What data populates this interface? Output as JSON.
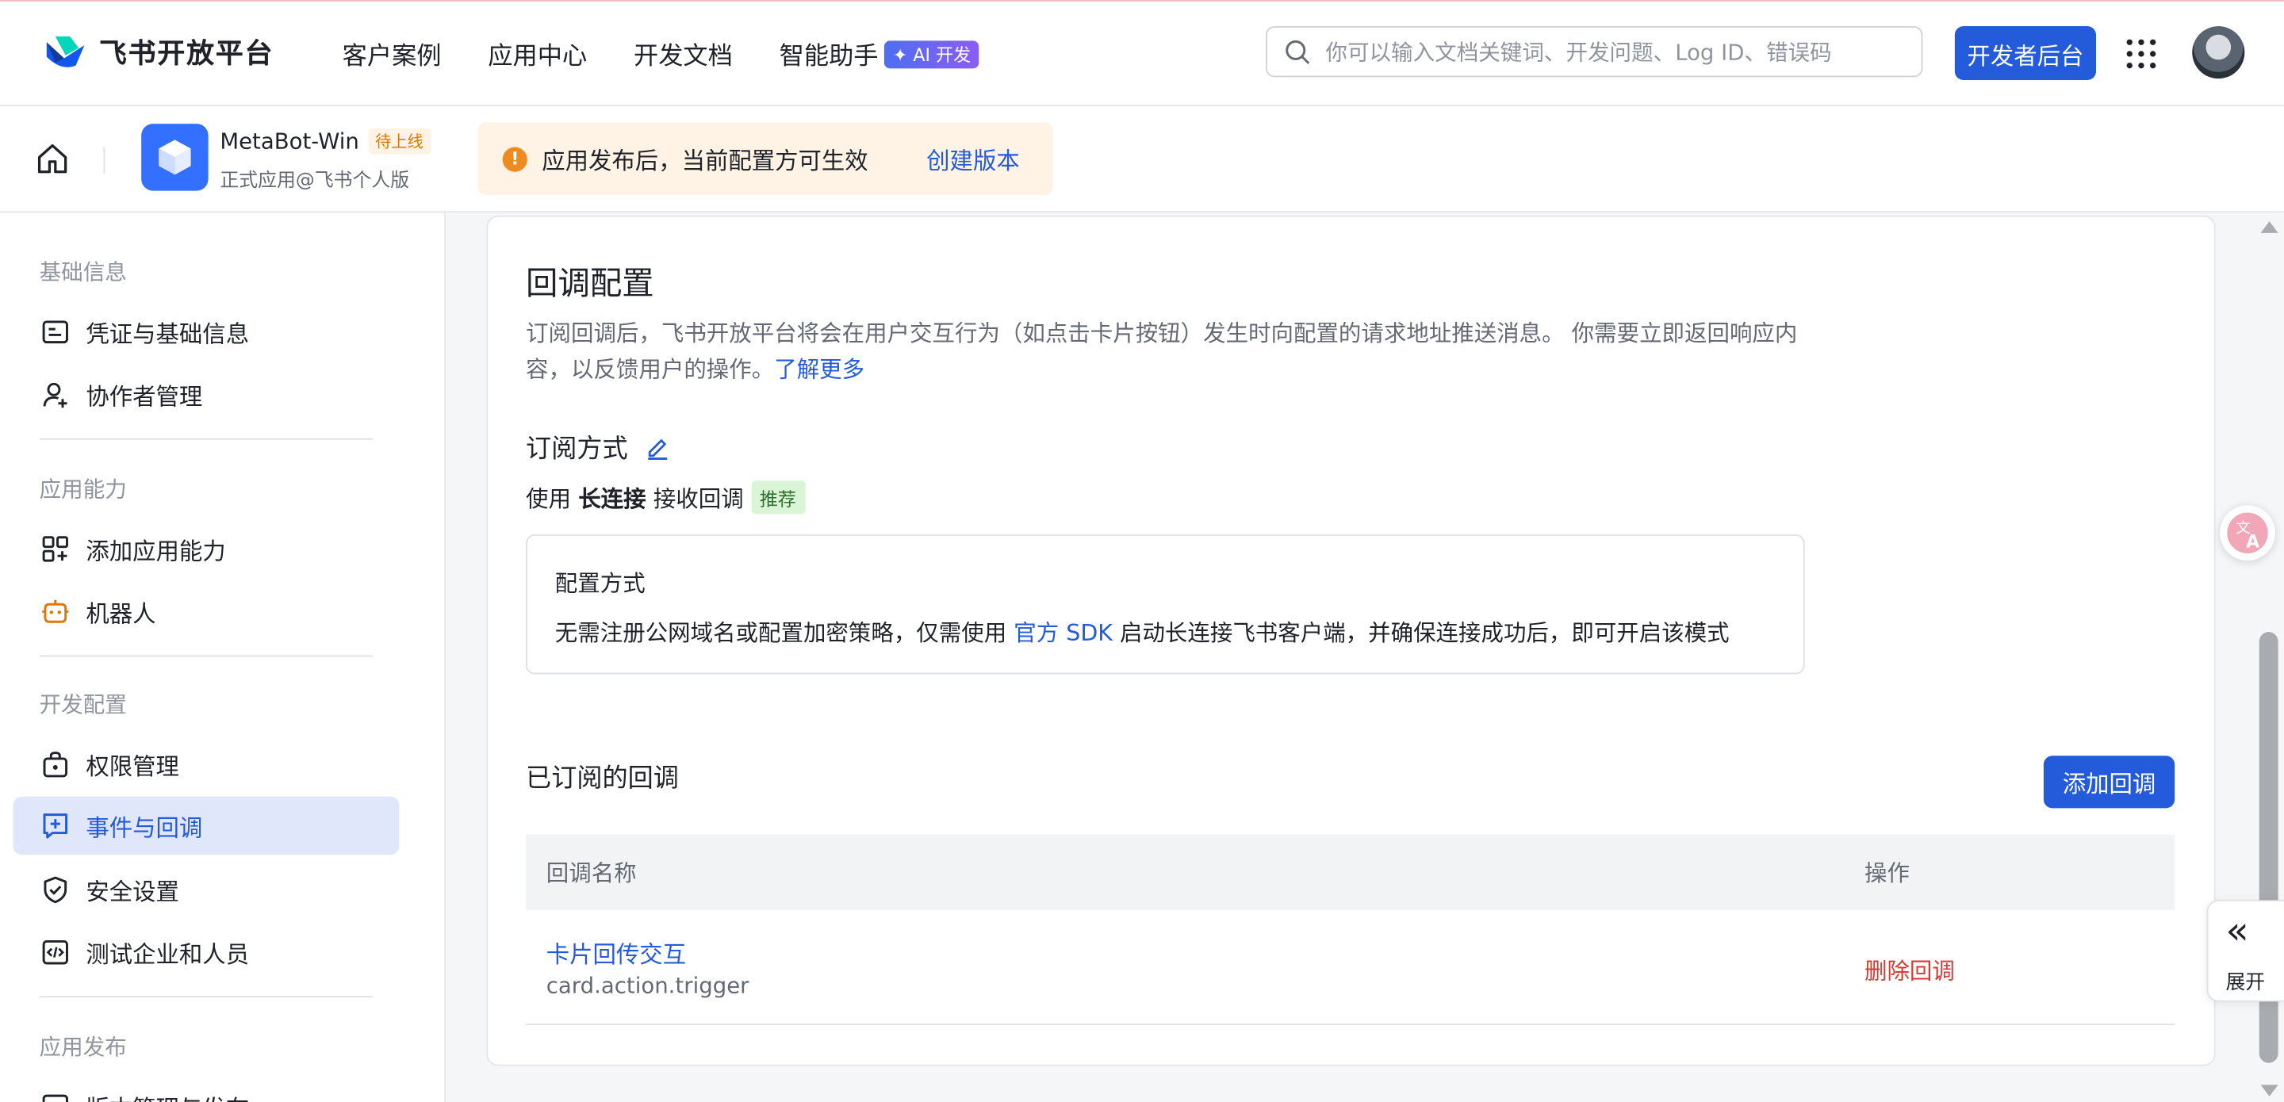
{
  "topnav": {
    "brand": "飞书开放平台",
    "links": [
      "客户案例",
      "应用中心",
      "开发文档",
      "智能助手"
    ],
    "ai_badge": "AI 开发",
    "search_placeholder": "你可以输入文档关键词、开发问题、Log ID、错误码",
    "dev_console": "开发者后台"
  },
  "app": {
    "name": "MetaBot-Win",
    "status": "待上线",
    "subtitle": "正式应用@飞书个人版",
    "notice": "应用发布后，当前配置方可生效",
    "notice_action": "创建版本"
  },
  "sidebar": {
    "sections": [
      {
        "title": "基础信息",
        "items": [
          {
            "label": "凭证与基础信息",
            "icon": "id-card-icon"
          },
          {
            "label": "协作者管理",
            "icon": "user-add-icon"
          }
        ]
      },
      {
        "title": "应用能力",
        "items": [
          {
            "label": "添加应用能力",
            "icon": "apps-add-icon"
          },
          {
            "label": "机器人",
            "icon": "robot-icon"
          }
        ]
      },
      {
        "title": "开发配置",
        "items": [
          {
            "label": "权限管理",
            "icon": "permission-icon"
          },
          {
            "label": "事件与回调",
            "icon": "event-icon",
            "active": true
          },
          {
            "label": "安全设置",
            "icon": "shield-icon"
          },
          {
            "label": "测试企业和人员",
            "icon": "code-icon"
          }
        ]
      },
      {
        "title": "应用发布",
        "items": [
          {
            "label": "版本管理与发布",
            "icon": "version-icon"
          }
        ]
      }
    ]
  },
  "main": {
    "title": "回调配置",
    "description": "订阅回调后，飞书开放平台将会在用户交互行为（如点击卡片按钮）发生时向配置的请求地址推送消息。 你需要立即返回响应内容，以反馈用户的操作。",
    "learn_more": "了解更多",
    "subscription_title": "订阅方式",
    "mode_prefix": "使用",
    "mode_name": "长连接",
    "mode_suffix": "接收回调",
    "recommended": "推荐",
    "config": {
      "title": "配置方式",
      "desc_before": "无需注册公网域名或配置加密策略，仅需使用",
      "desc_link": "官方 SDK",
      "desc_after": "启动长连接飞书客户端，并确保连接成功后，即可开启该模式"
    },
    "subscribed_title": "已订阅的回调",
    "add_button": "添加回调",
    "table": {
      "headers": [
        "回调名称",
        "操作"
      ],
      "rows": [
        {
          "name": "卡片回传交互",
          "key": "card.action.trigger",
          "action": "删除回调"
        }
      ]
    }
  },
  "expand_label": "展开",
  "colors": {
    "primary": "#245bdb",
    "danger": "#d83931",
    "warning_bg": "#fff3e5",
    "active_bg": "#e1e7fb"
  }
}
